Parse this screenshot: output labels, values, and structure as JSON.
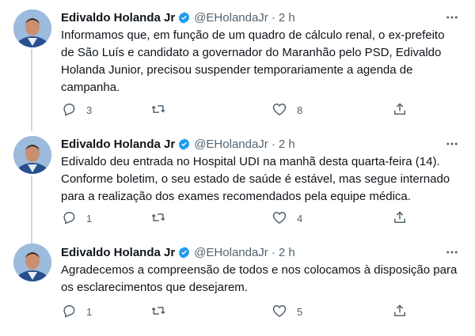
{
  "author": {
    "name": "Edivaldo Holanda Jr",
    "handle": "@EHolandaJr",
    "separator": "·"
  },
  "tweets": [
    {
      "time": "2 h",
      "text": "Informamos que, em função de um quadro de cálculo renal, o ex-prefeito de São Luís e candidato a governador do Maranhão pelo PSD, Edivaldo Holanda Junior, precisou suspender temporariamente a agenda de campanha.",
      "replies": "3",
      "retweets": "",
      "likes": "8"
    },
    {
      "time": "2 h",
      "text": "Edivaldo deu entrada no Hospital UDI na manhã desta quarta-feira (14). Conforme boletim, o seu estado de saúde é estável, mas segue internado para a realização dos exames recomendados pela equipe médica.",
      "replies": "1",
      "retweets": "",
      "likes": "4"
    },
    {
      "time": "2 h",
      "text": "Agradecemos a compreensão de todos e nos colocamos à disposição para os esclarecimentos que desejarem.",
      "replies": "1",
      "retweets": "",
      "likes": "5"
    }
  ],
  "colors": {
    "verified": "#1d9bf0",
    "secondary_text": "#536471",
    "thread_line": "#cfd9de"
  },
  "icons": [
    "verified-badge-icon",
    "more-icon",
    "reply-icon",
    "retweet-icon",
    "like-icon",
    "share-icon"
  ]
}
